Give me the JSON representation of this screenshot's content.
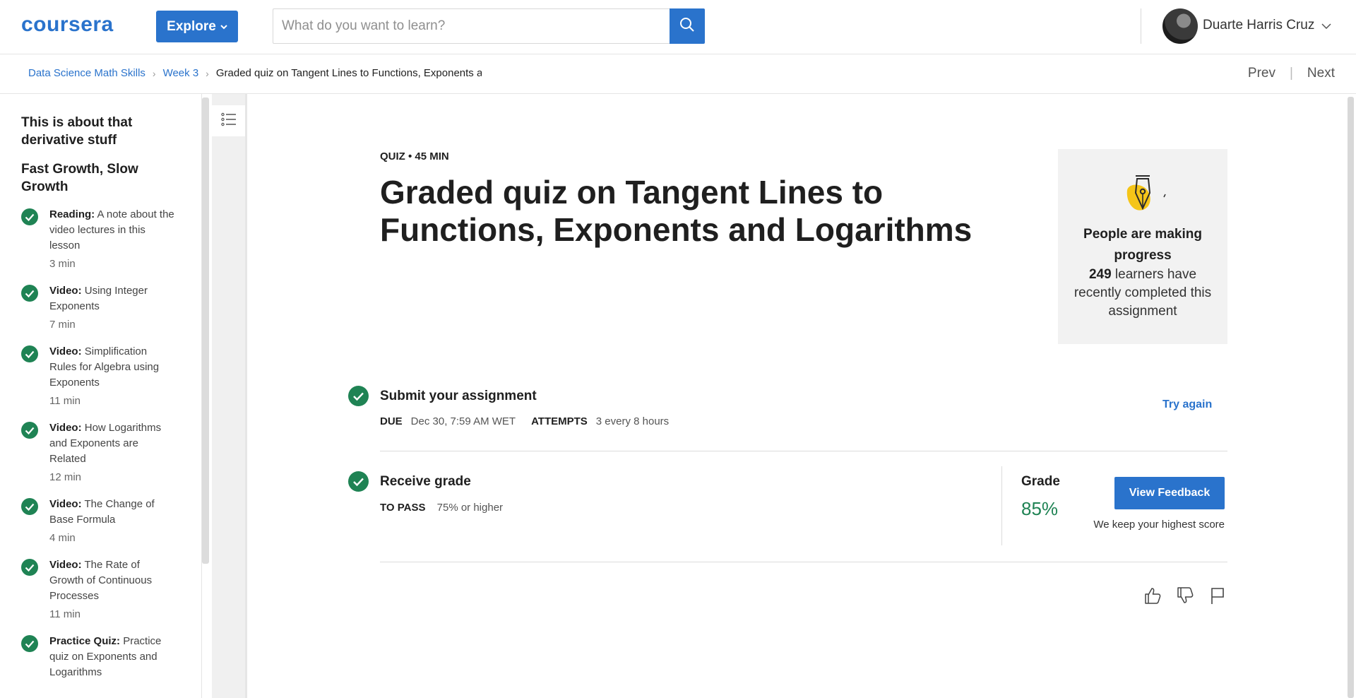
{
  "header": {
    "logo_text": "coursera",
    "explore_label": "Explore",
    "search_placeholder": "What do you want to learn?",
    "user_name": "Duarte Harris Cruz"
  },
  "breadcrumb": {
    "items": [
      "Data Science Math Skills",
      "Week 3"
    ],
    "current": "Graded quiz on Tangent Lines to Functions, Exponents and Logarithms"
  },
  "nav": {
    "prev": "Prev",
    "next": "Next"
  },
  "sidebar": {
    "module_title": "This is about that derivative stuff",
    "lesson_title": "Fast Growth, Slow Growth",
    "items": [
      {
        "type": "Reading:",
        "title": "A note about the video lectures in this lesson",
        "duration": "3 min"
      },
      {
        "type": "Video:",
        "title": "Using Integer Exponents",
        "duration": "7 min"
      },
      {
        "type": "Video:",
        "title": "Simplification Rules for Algebra using Exponents",
        "duration": "11 min"
      },
      {
        "type": "Video:",
        "title": "How Logarithms and Exponents are Related",
        "duration": "12 min"
      },
      {
        "type": "Video:",
        "title": "The Change of Base Formula",
        "duration": "4 min"
      },
      {
        "type": "Video:",
        "title": "The Rate of Growth of Continuous Processes",
        "duration": "11 min"
      },
      {
        "type": "Practice Quiz:",
        "title": "Practice quiz on Exponents and Logarithms",
        "duration": ""
      }
    ]
  },
  "quiz": {
    "meta": "QUIZ • 45 MIN",
    "title": "Graded quiz on Tangent Lines to Functions, Exponents and Logarithms"
  },
  "progress_card": {
    "heading": "People are making progress",
    "count": "249",
    "text": "learners have recently completed this assignment"
  },
  "submit": {
    "title": "Submit your assignment",
    "due_label": "DUE",
    "due_value": "Dec 30, 7:59 AM WET",
    "attempts_label": "ATTEMPTS",
    "attempts_value": "3 every 8 hours",
    "try_again": "Try again"
  },
  "grade": {
    "title": "Receive grade",
    "pass_label": "TO PASS",
    "pass_value": "75% or higher",
    "grade_label": "Grade",
    "grade_value": "85%",
    "feedback_button": "View Feedback",
    "keep_note": "We keep your highest score"
  },
  "colors": {
    "brand": "#2a73cc",
    "success": "#1f8354",
    "pen_accent": "#f5c518"
  }
}
